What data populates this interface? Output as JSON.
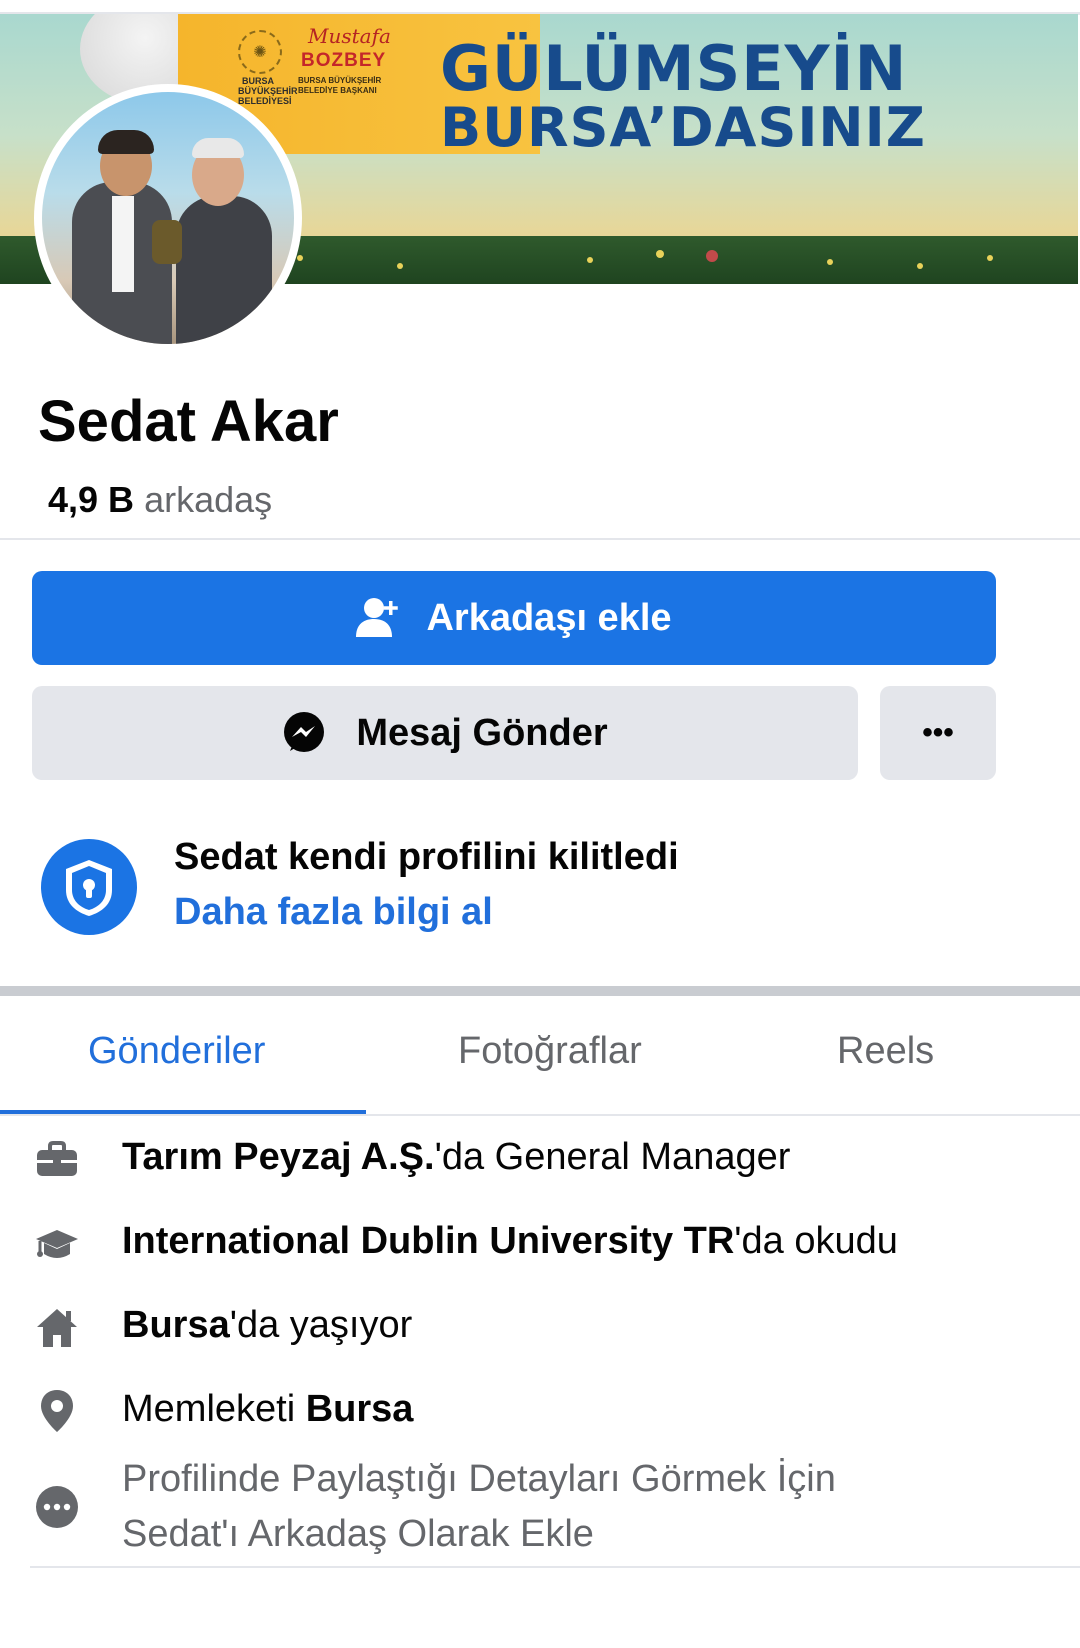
{
  "cover": {
    "banner_script": "Mustafa",
    "banner_name": "BOZBEY",
    "banner_office": "BURSA BÜYÜKŞEHİR BELEDİYE BAŞKANI",
    "banner_city": "BURSA BÜYÜKŞEHİR BELEDİYESİ",
    "slogan_line1": "GÜLÜMSEYİN",
    "slogan_line2": "BURSA’DASINIZ"
  },
  "profile": {
    "name": "Sedat Akar",
    "friend_count": "4,9 B",
    "friend_label": "arkadaş"
  },
  "actions": {
    "add_friend_label": "Arkadaşı ekle",
    "message_label": "Mesaj Gönder",
    "more_label": "•••"
  },
  "lock_notice": {
    "title": "Sedat kendi profilini kilitledi",
    "link": "Daha fazla bilgi al"
  },
  "tabs": [
    {
      "label": "Gönderiler",
      "active": true
    },
    {
      "label": "Fotoğraflar",
      "active": false
    },
    {
      "label": "Reels",
      "active": false
    }
  ],
  "intro": {
    "work": {
      "bold": "Tarım Peyzaj A.Ş.",
      "rest": "'da General Manager"
    },
    "education": {
      "bold": "International Dublin University TR",
      "rest": "'da okudu"
    },
    "lives": {
      "bold": "Bursa",
      "rest": "'da yaşıyor"
    },
    "hometown": {
      "prefix": "Memleketi ",
      "bold": "Bursa"
    },
    "note_line1": "Profilinde Paylaştığı Detayları Görmek İçin",
    "note_line2": "Sedat'ı Arkadaş Olarak Ekle"
  },
  "colors": {
    "primary": "#1b74e4",
    "link": "#216fdb",
    "secondary_bg": "#e4e6eb",
    "muted_text": "#65676b"
  },
  "icons": [
    "add-friend-icon",
    "messenger-icon",
    "more-icon",
    "shield-lock-icon",
    "briefcase-icon",
    "graduation-cap-icon",
    "home-icon",
    "location-pin-icon",
    "more-dots-icon"
  ]
}
